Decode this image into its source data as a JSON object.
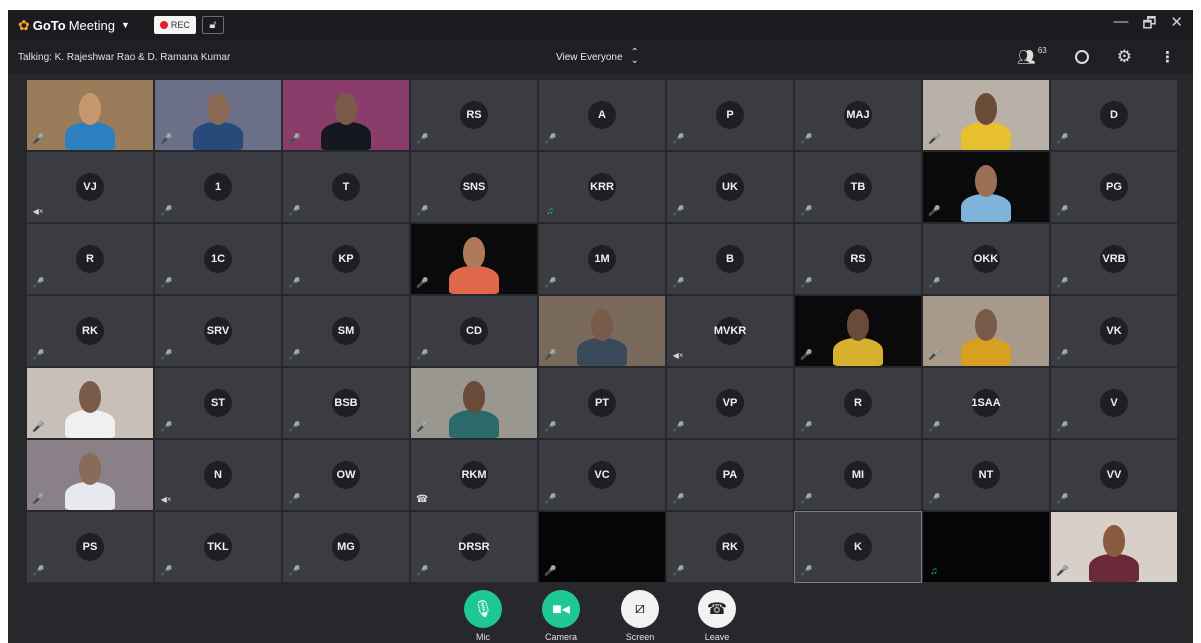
{
  "titlebar": {
    "app_name_bold": "GoTo",
    "app_name_rest": "Meeting",
    "rec_label": "REC",
    "minimize": "—",
    "restore": "🗗",
    "close": "✕"
  },
  "infobar": {
    "talking": "Talking: K. Rajeshwar Rao & D. Ramana Kumar",
    "view_selector": "View Everyone",
    "participants_count": "63"
  },
  "tiles": [
    {
      "type": "video",
      "mic": "on"
    },
    {
      "type": "video",
      "mic": "on"
    },
    {
      "type": "video",
      "mic": "muted"
    },
    {
      "initials": "RS",
      "mic": "muted"
    },
    {
      "initials": "A",
      "mic": "muted"
    },
    {
      "initials": "P",
      "mic": "muted"
    },
    {
      "initials": "MAJ",
      "mic": "muted"
    },
    {
      "type": "video",
      "mic": "muted"
    },
    {
      "initials": "D",
      "mic": "muted"
    },
    {
      "initials": "VJ",
      "mic": "nospk"
    },
    {
      "initials": "1",
      "mic": "muted"
    },
    {
      "initials": "T",
      "mic": "muted"
    },
    {
      "initials": "SNS",
      "mic": "muted"
    },
    {
      "initials": "KRR",
      "mic": "speaking"
    },
    {
      "initials": "UK",
      "mic": "muted"
    },
    {
      "initials": "TB",
      "mic": "muted"
    },
    {
      "type": "video",
      "mic": "muted"
    },
    {
      "initials": "PG",
      "mic": "muted"
    },
    {
      "initials": "R",
      "mic": "muted"
    },
    {
      "initials": "1C",
      "mic": "muted"
    },
    {
      "initials": "KP",
      "mic": "muted"
    },
    {
      "type": "video",
      "mic": "muted"
    },
    {
      "initials": "1M",
      "mic": "muted"
    },
    {
      "initials": "B",
      "mic": "muted"
    },
    {
      "initials": "RS",
      "mic": "muted"
    },
    {
      "initials": "OKK",
      "mic": "muted"
    },
    {
      "initials": "VRB",
      "mic": "muted"
    },
    {
      "initials": "RK",
      "mic": "muted"
    },
    {
      "initials": "SRV",
      "mic": "muted"
    },
    {
      "initials": "SM",
      "mic": "muted"
    },
    {
      "initials": "CD",
      "mic": "muted"
    },
    {
      "type": "video",
      "mic": "muted"
    },
    {
      "initials": "MVKR",
      "mic": "nospk"
    },
    {
      "type": "video",
      "mic": "muted"
    },
    {
      "type": "video",
      "mic": "muted"
    },
    {
      "initials": "VK",
      "mic": "muted"
    },
    {
      "type": "video",
      "mic": "muted"
    },
    {
      "initials": "ST",
      "mic": "on"
    },
    {
      "initials": "BSB",
      "mic": "muted"
    },
    {
      "type": "video",
      "mic": "muted"
    },
    {
      "initials": "PT",
      "mic": "muted"
    },
    {
      "initials": "VP",
      "mic": "muted"
    },
    {
      "initials": "R",
      "mic": "muted"
    },
    {
      "initials": "1SAA",
      "mic": "muted"
    },
    {
      "initials": "V",
      "mic": "muted"
    },
    {
      "type": "video",
      "mic": "muted"
    },
    {
      "initials": "N",
      "mic": "nospk"
    },
    {
      "initials": "OW",
      "mic": "muted"
    },
    {
      "initials": "RKM",
      "mic": "phone"
    },
    {
      "initials": "VC",
      "mic": "muted"
    },
    {
      "initials": "PA",
      "mic": "muted"
    },
    {
      "initials": "MI",
      "mic": "muted"
    },
    {
      "initials": "NT",
      "mic": "muted"
    },
    {
      "initials": "VV",
      "mic": "muted"
    },
    {
      "initials": "PS",
      "mic": "muted"
    },
    {
      "initials": "TKL",
      "mic": "muted"
    },
    {
      "initials": "MG",
      "mic": "muted"
    },
    {
      "initials": "DRSR",
      "mic": "muted"
    },
    {
      "type": "black",
      "mic": "muted"
    },
    {
      "initials": "RK",
      "mic": "muted"
    },
    {
      "initials": "K",
      "mic": "on",
      "selected": true
    },
    {
      "type": "black",
      "mic": "speaking"
    },
    {
      "type": "video",
      "mic": "muted"
    }
  ],
  "toolbar": {
    "mic": "Mic",
    "camera": "Camera",
    "screen": "Screen",
    "leave": "Leave"
  }
}
